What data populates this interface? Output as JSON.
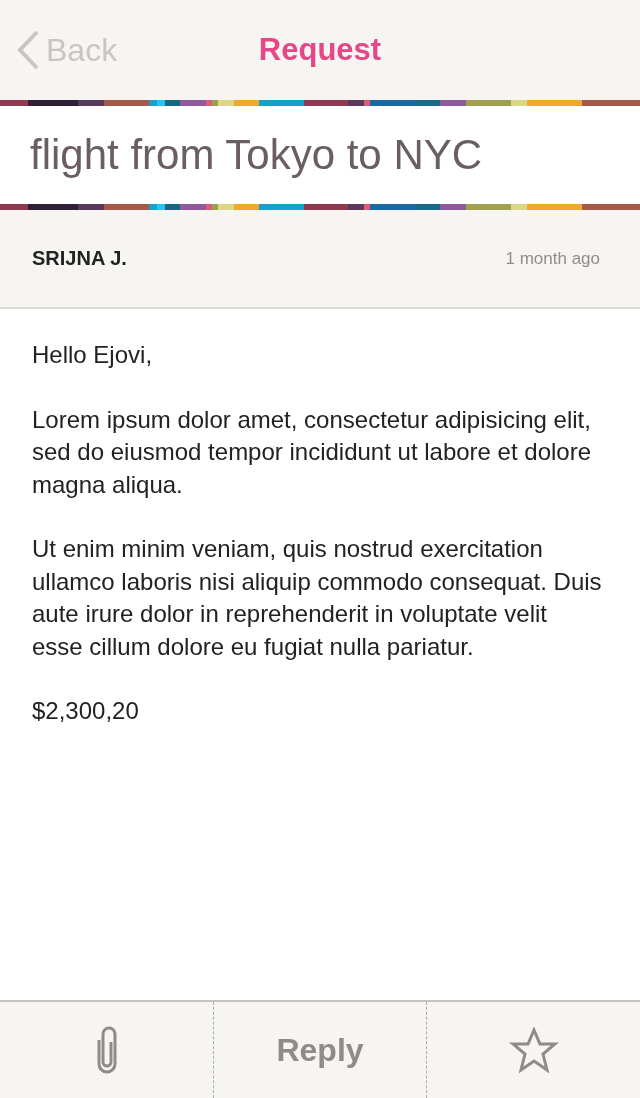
{
  "nav": {
    "back": "Back",
    "title": "Request"
  },
  "subject": "flight from Tokyo to NYC",
  "meta": {
    "sender": "SRIJNA J.",
    "time": "1 month ago"
  },
  "body": [
    "Hello Ejovi,",
    "Lorem ipsum dolor amet, consectetur adipisicing elit, sed do eiusmod tempor incididunt ut labore et dolore magna aliqua.",
    "Ut enim minim veniam, quis nostrud exercitation ullamco laboris nisi aliquip commodo consequat. Duis aute irure dolor in reprehenderit in voluptate velit esse cillum dolore eu fugiat nulla pariatur.",
    "$2,300,20"
  ],
  "toolbar": {
    "reply": "Reply",
    "starred": false
  }
}
